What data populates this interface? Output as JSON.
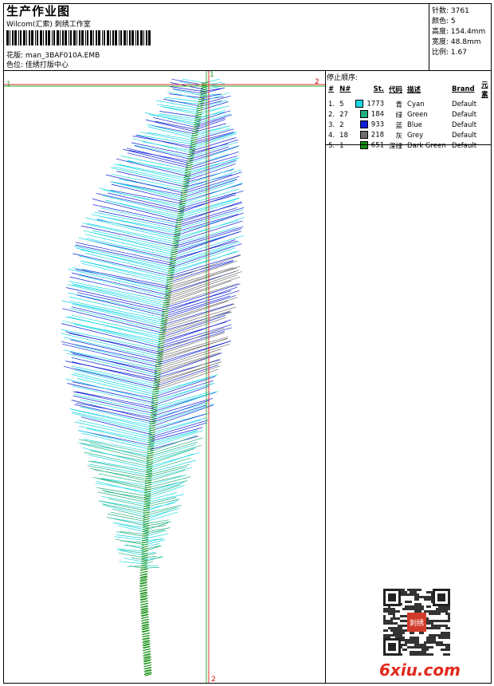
{
  "header": {
    "title": "生产作业图",
    "company": "Wilcom(汇索) 刺绣工作室",
    "design_label": "花版:",
    "design_value": "man_3BAF010A.EMB",
    "colorway_label": "色位:",
    "colorway_value": "佳绣打版中心"
  },
  "stats": {
    "stitches_label": "针数:",
    "stitches_value": "3761",
    "colors_label": "颜色:",
    "colors_value": "5",
    "height_label": "高度:",
    "height_value": "154.4mm",
    "width_label": "宽度:",
    "width_value": "48.8mm",
    "scale_label": "比例:",
    "scale_value": "1.67"
  },
  "stop_sequence": {
    "title": "停止顺序:",
    "columns": [
      "#",
      "N#",
      "St.",
      "代码",
      "描述",
      "Brand",
      "元素"
    ],
    "rows": [
      {
        "idx": "1.",
        "n": "5",
        "color": "#19d7e3",
        "st": "1773",
        "code": "青",
        "desc": "Cyan",
        "brand": "Default"
      },
      {
        "idx": "2.",
        "n": "27",
        "color": "#1db17d",
        "st": "184",
        "code": "绿",
        "desc": "Green",
        "brand": "Default"
      },
      {
        "idx": "3.",
        "n": "2",
        "color": "#0b1ed6",
        "st": "933",
        "code": "蓝",
        "desc": "Blue",
        "brand": "Default"
      },
      {
        "idx": "4.",
        "n": "18",
        "color": "#6f6f6f",
        "st": "218",
        "code": "灰",
        "desc": "Grey",
        "brand": "Default"
      },
      {
        "idx": "5.",
        "n": "1",
        "color": "#138f12",
        "st": "651",
        "code": "深绿",
        "desc": "Dark Green",
        "brand": "Default"
      }
    ]
  },
  "guides": {
    "h_left": "1",
    "h_right": "2",
    "v_top": "1",
    "v_bottom": "2"
  },
  "watermark": "6xiu.com",
  "qr_stamp": "刺绣"
}
